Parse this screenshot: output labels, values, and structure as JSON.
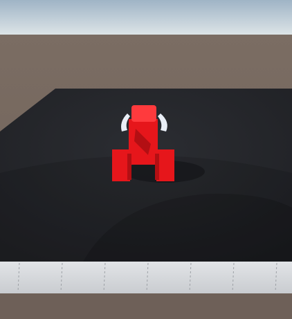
{
  "scene": {
    "kind": "3d-game-viewport",
    "hud_text": [],
    "colors": {
      "sky_top": "#9fb4c6",
      "sky_horizon": "#dfe6e8",
      "ground_far": "#7b6d63",
      "ground_near": "#6e6058",
      "arena_floor": "#2b2d32",
      "arena_floor_dark": "#1f2024",
      "wall_face": "#c9ccd0",
      "wall_top": "#e2e4e7",
      "wall_seam": "#9da1a6",
      "robot_red": "#e6161b",
      "robot_red_dark": "#b30f13",
      "robot_red_light": "#ff3a3d",
      "robot_claw": "#e9eef6",
      "shadow": "#141518"
    },
    "objects": {
      "robot": {
        "name": "red-robot",
        "icon": "robot-icon"
      },
      "arena": {
        "name": "arena-floor"
      },
      "wall": {
        "name": "arena-wall"
      }
    }
  }
}
